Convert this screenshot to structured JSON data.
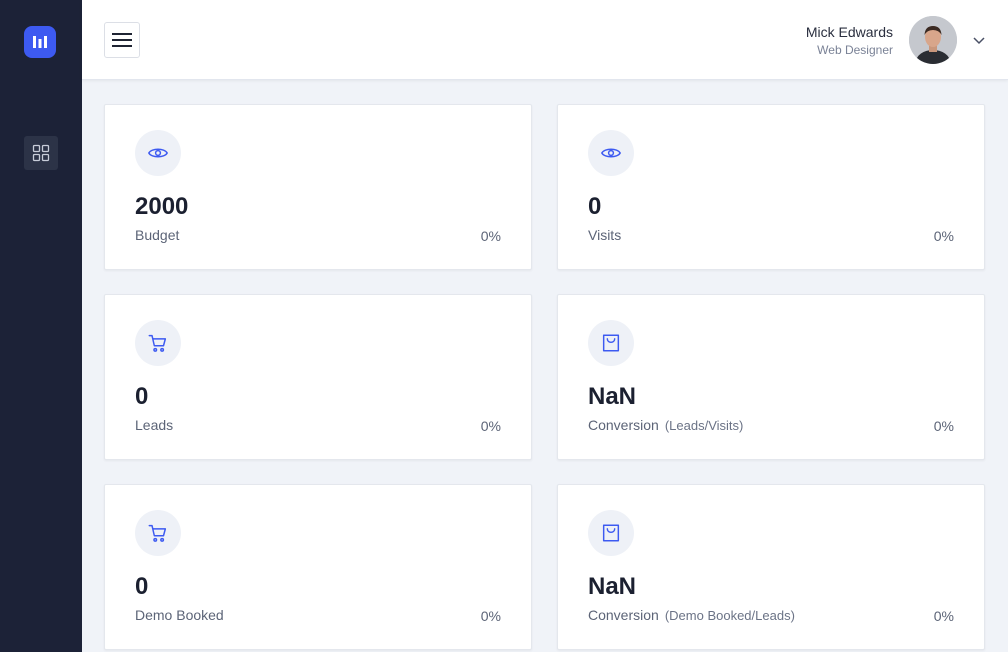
{
  "user": {
    "name": "Mick Edwards",
    "role": "Web Designer"
  },
  "cards": [
    {
      "value": "2000",
      "label": "Budget",
      "sub": "",
      "percent": "0%",
      "icon": "eye-icon"
    },
    {
      "value": "0",
      "label": "Visits",
      "sub": "",
      "percent": "0%",
      "icon": "eye-icon"
    },
    {
      "value": "0",
      "label": "Leads",
      "sub": "",
      "percent": "0%",
      "icon": "cart-icon"
    },
    {
      "value": "NaN",
      "label": "Conversion",
      "sub": "(Leads/Visits)",
      "percent": "0%",
      "icon": "shopping-bag-icon"
    },
    {
      "value": "0",
      "label": "Demo Booked",
      "sub": "",
      "percent": "0%",
      "icon": "cart-icon"
    },
    {
      "value": "NaN",
      "label": "Conversion",
      "sub": "(Demo Booked/Leads)",
      "percent": "0%",
      "icon": "shopping-bag-icon"
    }
  ],
  "colors": {
    "sidebar": "#1c2237",
    "accent": "#3d5af1",
    "background": "#f0f3f8"
  }
}
